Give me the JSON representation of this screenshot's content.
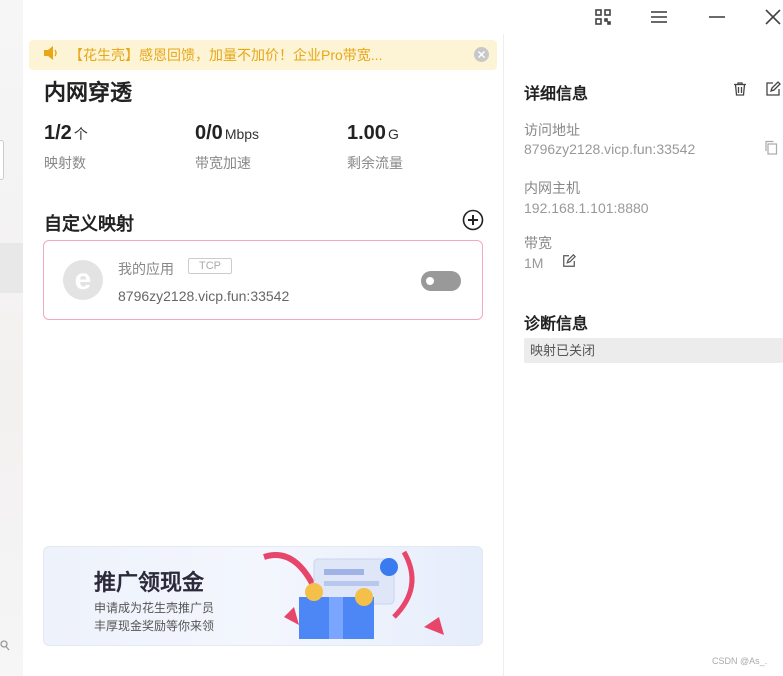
{
  "notice": {
    "text": "【花生壳】感恩回馈，加量不加价！企业Pro带宽..."
  },
  "page": {
    "title": "内网穿透"
  },
  "stats": [
    {
      "value": "1/2",
      "unit": "个",
      "label": "映射数"
    },
    {
      "value": "0/0",
      "unit": "Mbps",
      "label": "带宽加速"
    },
    {
      "value": "1.00",
      "unit": "G",
      "label": "剩余流量"
    }
  ],
  "custom_mapping": {
    "title": "自定义映射",
    "items": [
      {
        "name": "我的应用",
        "protocol": "TCP",
        "address": "8796zy2128.vicp.fun:33542",
        "enabled": false
      }
    ]
  },
  "banner": {
    "title": "推广领现金",
    "line1": "申请成为花生壳推广员",
    "line2": "丰厚现金奖励等你来领"
  },
  "details": {
    "title": "详细信息",
    "access_label": "访问地址",
    "access_value": "8796zy2128.vicp.fun:33542",
    "host_label": "内网主机",
    "host_value": "192.168.1.101:8880",
    "bandwidth_label": "带宽",
    "bandwidth_value": "1M"
  },
  "diagnostics": {
    "title": "诊断信息",
    "status": "映射已关闭"
  },
  "watermark": "CSDN @As_.",
  "colors": {
    "notice_text": "#e6a817",
    "card_border": "#f3a8bd",
    "toggle_off": "#999999"
  }
}
